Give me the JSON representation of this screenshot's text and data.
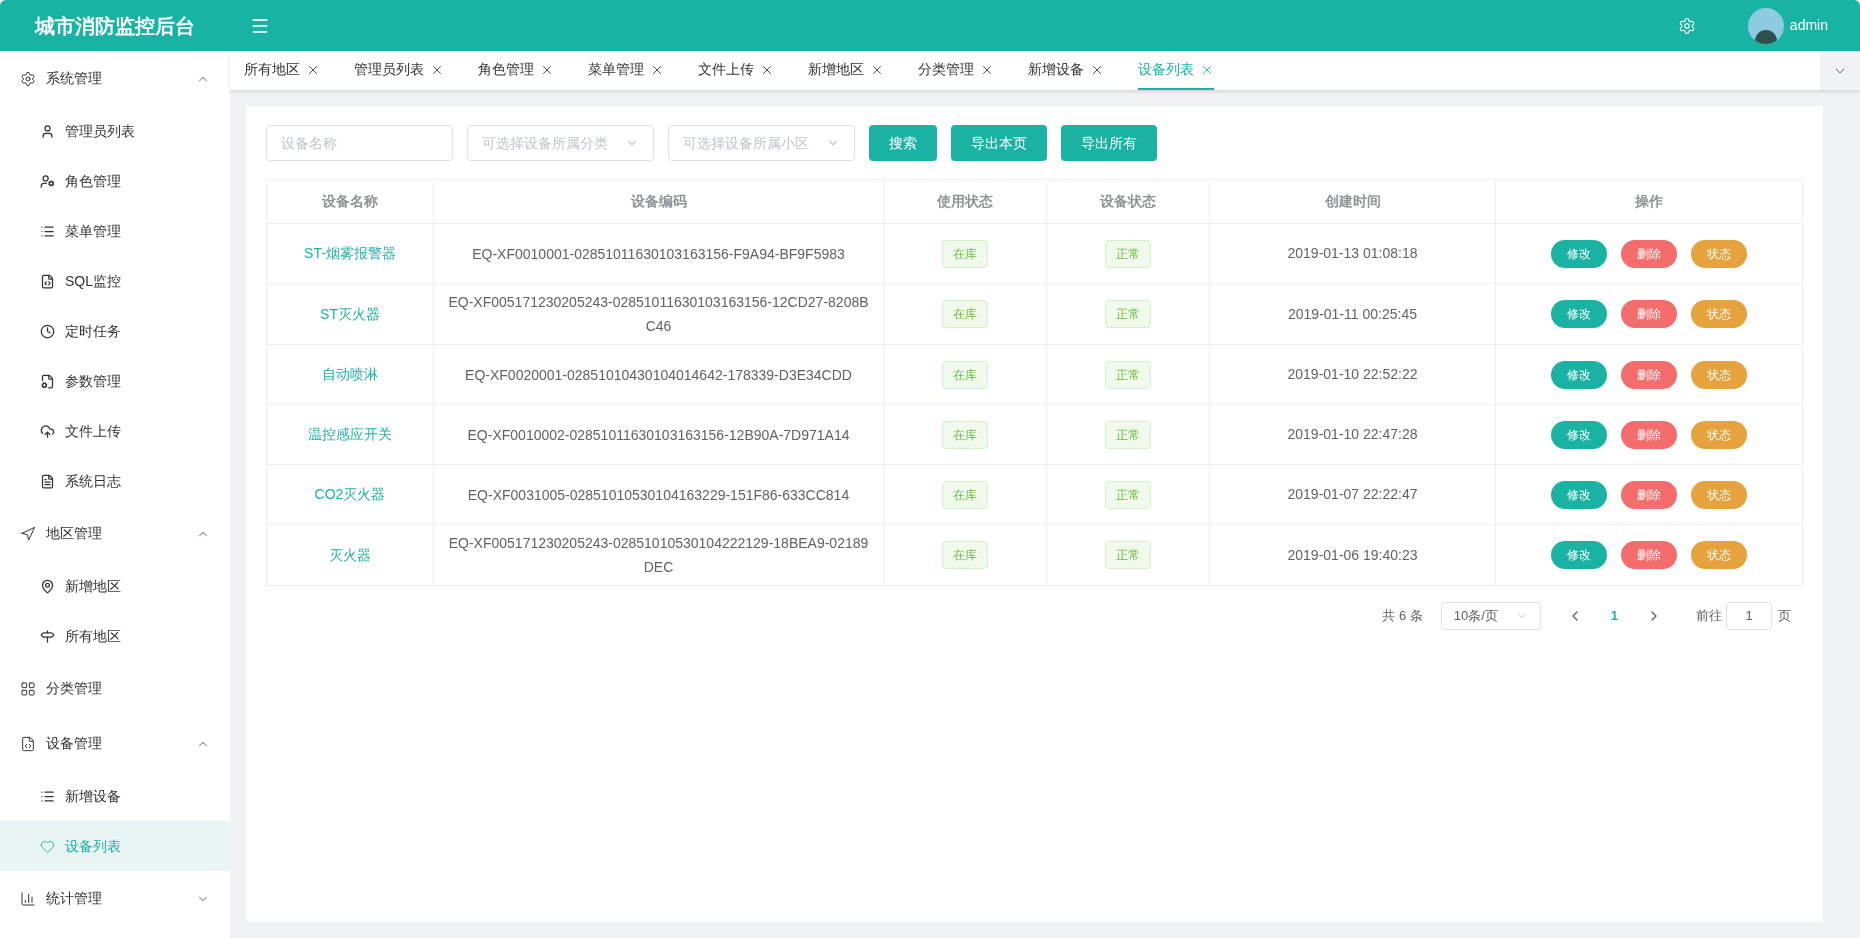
{
  "header": {
    "title": "城市消防监控后台",
    "user": "admin"
  },
  "sidebar": {
    "items": [
      {
        "label": "系统管理",
        "expanded": true,
        "selected": false,
        "children": [
          {
            "label": "管理员列表",
            "selected": false
          },
          {
            "label": "角色管理",
            "selected": false
          },
          {
            "label": "菜单管理",
            "selected": false
          },
          {
            "label": "SQL监控",
            "selected": false
          },
          {
            "label": "定时任务",
            "selected": false
          },
          {
            "label": "参数管理",
            "selected": false
          },
          {
            "label": "文件上传",
            "selected": false
          },
          {
            "label": "系统日志",
            "selected": false
          }
        ]
      },
      {
        "label": "地区管理",
        "expanded": true,
        "selected": false,
        "children": [
          {
            "label": "新增地区",
            "selected": false
          },
          {
            "label": "所有地区",
            "selected": false
          }
        ]
      },
      {
        "label": "分类管理",
        "selected": false
      },
      {
        "label": "设备管理",
        "expanded": true,
        "selected": false,
        "children": [
          {
            "label": "新增设备",
            "selected": false
          },
          {
            "label": "设备列表",
            "selected": true
          }
        ]
      },
      {
        "label": "统计管理",
        "expanded": false,
        "selected": false
      }
    ]
  },
  "tabs": [
    {
      "label": "所有地区",
      "selected": false
    },
    {
      "label": "管理员列表",
      "selected": false
    },
    {
      "label": "角色管理",
      "selected": false
    },
    {
      "label": "菜单管理",
      "selected": false
    },
    {
      "label": "文件上传",
      "selected": false
    },
    {
      "label": "新增地区",
      "selected": false
    },
    {
      "label": "分类管理",
      "selected": false
    },
    {
      "label": "新增设备",
      "selected": false
    },
    {
      "label": "设备列表",
      "selected": true
    }
  ],
  "filters": {
    "fields": [
      {
        "kind": "text",
        "placeholder": "设备名称"
      },
      {
        "kind": "select",
        "placeholder": "可选择设备所属分类"
      },
      {
        "kind": "select",
        "placeholder": "可选择设备所属小区"
      }
    ],
    "buttons": [
      "搜索",
      "导出本页",
      "导出所有"
    ]
  },
  "table": {
    "columns": [
      "设备名称",
      "设备编码",
      "使用状态",
      "设备状态",
      "创建时间",
      "操作"
    ],
    "rows": [
      {
        "name": "ST-烟雾报警器",
        "code": "EQ-XF0010001-02851011630103163156-F9A94-BF9F5983",
        "usage": "在库",
        "status": "正常",
        "created": "2019-01-13 01:08:18",
        "actions": [
          {
            "kind": "edit",
            "label": "修改"
          },
          {
            "kind": "delete",
            "label": "删除"
          },
          {
            "kind": "state",
            "label": "状态"
          }
        ]
      },
      {
        "name": "ST灭火器",
        "code": "EQ-XF005171230205243-02851011630103163156-12CD27-8208BC46",
        "usage": "在库",
        "status": "正常",
        "created": "2019-01-11 00:25:45",
        "actions": [
          {
            "kind": "edit",
            "label": "修改"
          },
          {
            "kind": "delete",
            "label": "删除"
          },
          {
            "kind": "state",
            "label": "状态"
          }
        ]
      },
      {
        "name": "自动喷淋",
        "code": "EQ-XF0020001-02851010430104014642-178339-D3E34CDD",
        "usage": "在库",
        "status": "正常",
        "created": "2019-01-10 22:52:22",
        "actions": [
          {
            "kind": "edit",
            "label": "修改"
          },
          {
            "kind": "delete",
            "label": "删除"
          },
          {
            "kind": "state",
            "label": "状态"
          }
        ]
      },
      {
        "name": "温控感应开关",
        "code": "EQ-XF0010002-02851011630103163156-12B90A-7D971A14",
        "usage": "在库",
        "status": "正常",
        "created": "2019-01-10 22:47:28",
        "actions": [
          {
            "kind": "edit",
            "label": "修改"
          },
          {
            "kind": "delete",
            "label": "删除"
          },
          {
            "kind": "state",
            "label": "状态"
          }
        ]
      },
      {
        "name": "CO2灭火器",
        "code": "EQ-XF0031005-02851010530104163229-151F86-633CC814",
        "usage": "在库",
        "status": "正常",
        "created": "2019-01-07 22:22:47",
        "actions": [
          {
            "kind": "edit",
            "label": "修改"
          },
          {
            "kind": "delete",
            "label": "删除"
          },
          {
            "kind": "state",
            "label": "状态"
          }
        ]
      },
      {
        "name": "灭火器",
        "code": "EQ-XF005171230205243-02851010530104222129-18BEA9-02189DEC",
        "usage": "在库",
        "status": "正常",
        "created": "2019-01-06 19:40:23",
        "actions": [
          {
            "kind": "edit",
            "label": "修改"
          },
          {
            "kind": "delete",
            "label": "删除"
          },
          {
            "kind": "state",
            "label": "状态"
          }
        ]
      }
    ]
  },
  "pagination": {
    "total": "共 6 条",
    "page_size": "10条/页",
    "pages": [
      {
        "label": "1",
        "selected": true
      }
    ],
    "goto_label": "前往",
    "goto_value": "1",
    "goto_suffix": "页"
  }
}
